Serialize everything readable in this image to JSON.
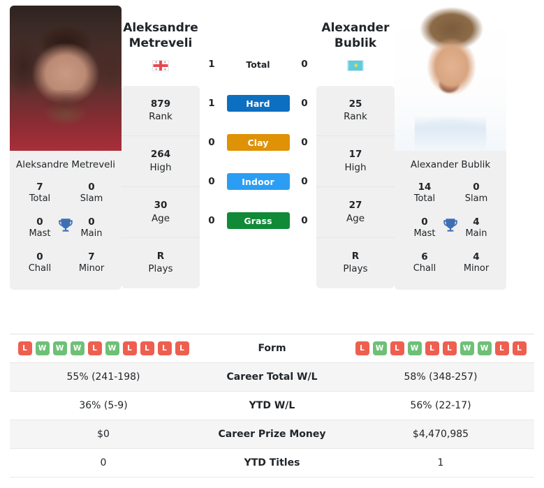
{
  "players": {
    "left": {
      "first_name": "Aleksandre",
      "last_name": "Metreveli",
      "full_name": "Aleksandre Metreveli",
      "flag": "georgia-flag-icon",
      "attributes": [
        {
          "value": "879",
          "label": "Rank"
        },
        {
          "value": "264",
          "label": "High"
        },
        {
          "value": "30",
          "label": "Age"
        },
        {
          "value": "R",
          "label": "Plays"
        }
      ],
      "titles": [
        {
          "value": "7",
          "label": "Total"
        },
        {
          "value": "0",
          "label": "Slam"
        },
        {
          "value": "0",
          "label": "Mast"
        },
        {
          "value": "0",
          "label": "Main"
        },
        {
          "value": "0",
          "label": "Chall"
        },
        {
          "value": "7",
          "label": "Minor"
        }
      ],
      "form": [
        "L",
        "W",
        "W",
        "W",
        "L",
        "W",
        "L",
        "L",
        "L",
        "L"
      ],
      "career_total_wl": "55% (241-198)",
      "ytd_wl": "36% (5-9)",
      "career_prize_money": "$0",
      "ytd_titles": "0"
    },
    "right": {
      "first_name": "Alexander",
      "last_name": "Bublik",
      "full_name": "Alexander Bublik",
      "flag": "kazakhstan-flag-icon",
      "attributes": [
        {
          "value": "25",
          "label": "Rank"
        },
        {
          "value": "17",
          "label": "High"
        },
        {
          "value": "27",
          "label": "Age"
        },
        {
          "value": "R",
          "label": "Plays"
        }
      ],
      "titles": [
        {
          "value": "14",
          "label": "Total"
        },
        {
          "value": "0",
          "label": "Slam"
        },
        {
          "value": "0",
          "label": "Mast"
        },
        {
          "value": "4",
          "label": "Main"
        },
        {
          "value": "6",
          "label": "Chall"
        },
        {
          "value": "4",
          "label": "Minor"
        }
      ],
      "form": [
        "L",
        "W",
        "L",
        "W",
        "L",
        "L",
        "W",
        "W",
        "L",
        "L"
      ],
      "career_total_wl": "58% (348-257)",
      "ytd_wl": "56% (22-17)",
      "career_prize_money": "$4,470,985",
      "ytd_titles": "1"
    }
  },
  "head_to_head": [
    {
      "label": "Total",
      "left": "1",
      "right": "0",
      "color": "",
      "chip": false
    },
    {
      "label": "Hard",
      "left": "1",
      "right": "0",
      "color": "#0d6fc0",
      "chip": true
    },
    {
      "label": "Clay",
      "left": "0",
      "right": "0",
      "color": "#df9205",
      "chip": true
    },
    {
      "label": "Indoor",
      "left": "0",
      "right": "0",
      "color": "#2b9ef4",
      "chip": true
    },
    {
      "label": "Grass",
      "left": "0",
      "right": "0",
      "color": "#118a38",
      "chip": true
    }
  ],
  "table": {
    "rows": [
      {
        "label": "Form",
        "key": "form"
      },
      {
        "label": "Career Total W/L",
        "key": "career_total_wl"
      },
      {
        "label": "YTD W/L",
        "key": "ytd_wl"
      },
      {
        "label": "Career Prize Money",
        "key": "career_prize_money"
      },
      {
        "label": "YTD Titles",
        "key": "ytd_titles"
      }
    ]
  },
  "colors": {
    "win": "#6ec077",
    "loss": "#ee5f4f",
    "card_bg": "#f0f0f0",
    "row_alt": "#f5f5f5",
    "trophy": "#3d6fb4"
  }
}
